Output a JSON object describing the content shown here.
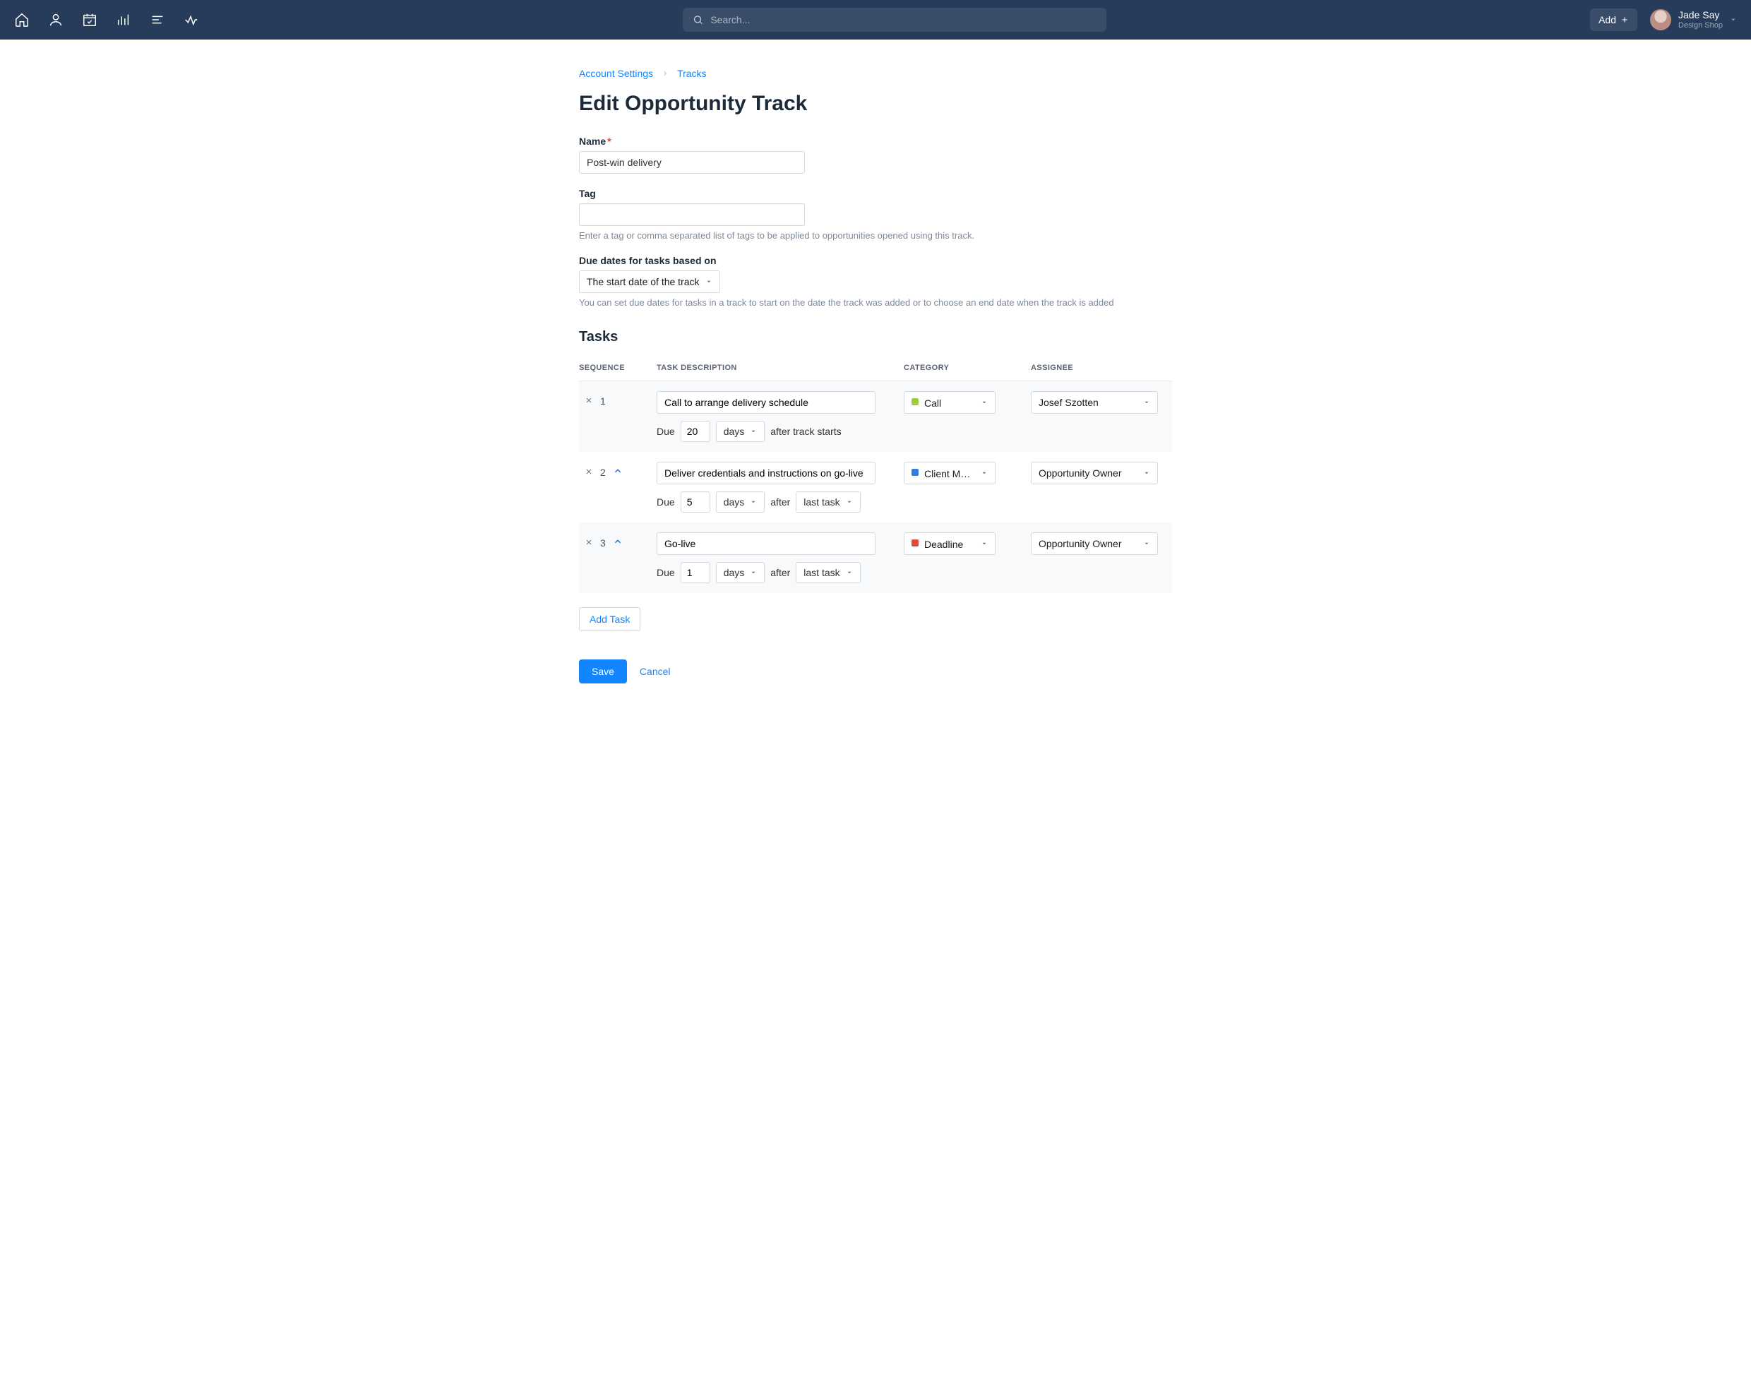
{
  "header": {
    "search_placeholder": "Search...",
    "add_label": "Add",
    "user": {
      "name": "Jade Say",
      "sub": "Design Shop"
    }
  },
  "breadcrumb": {
    "items": [
      "Account Settings",
      "Tracks"
    ]
  },
  "page": {
    "title": "Edit Opportunity Track",
    "name_label": "Name",
    "name_value": "Post-win delivery",
    "tag_label": "Tag",
    "tag_value": "",
    "tag_help": "Enter a tag or comma separated list of tags to be applied to opportunities opened using this track.",
    "duedate_label": "Due dates for tasks based on",
    "duedate_value": "The start date of the track",
    "duedate_help": "You can set due dates for tasks in a track to start on the date the track was added or to choose an end date when the track is added",
    "tasks_heading": "Tasks",
    "columns": {
      "sequence": "SEQUENCE",
      "description": "TASK DESCRIPTION",
      "category": "CATEGORY",
      "assignee": "ASSIGNEE"
    },
    "due_word": "Due",
    "after_track_starts": "after track starts",
    "after_word": "after",
    "unit_days": "days",
    "last_task": "last task",
    "tasks": [
      {
        "seq": "1",
        "description": "Call to arrange delivery schedule",
        "due_n": "20",
        "due_mode": "track_start",
        "category": {
          "label": "Call",
          "color": "#9ccb3c"
        },
        "assignee": "Josef Szotten",
        "show_up": false
      },
      {
        "seq": "2",
        "description": "Deliver credentials and instructions on go-live",
        "due_n": "5",
        "due_mode": "last_task",
        "category": {
          "label": "Client M…",
          "color": "#2f7de1"
        },
        "assignee": "Opportunity Owner",
        "show_up": true
      },
      {
        "seq": "3",
        "description": "Go-live",
        "due_n": "1",
        "due_mode": "last_task",
        "category": {
          "label": "Deadline",
          "color": "#e24b3b"
        },
        "assignee": "Opportunity Owner",
        "show_up": true
      }
    ],
    "add_task_label": "Add Task",
    "save_label": "Save",
    "cancel_label": "Cancel"
  }
}
